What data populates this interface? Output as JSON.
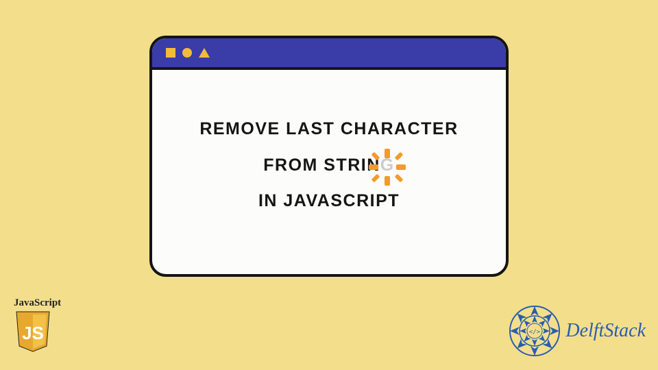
{
  "content": {
    "line1": "REMOVE LAST CHARACTER",
    "line2_prefix": "FROM STRIN",
    "line2_last": "G",
    "line3": "IN JAVASCRIPT"
  },
  "js_badge": {
    "label": "JavaScript",
    "shield_text": "JS"
  },
  "delft": {
    "brand": "DelftStack"
  }
}
